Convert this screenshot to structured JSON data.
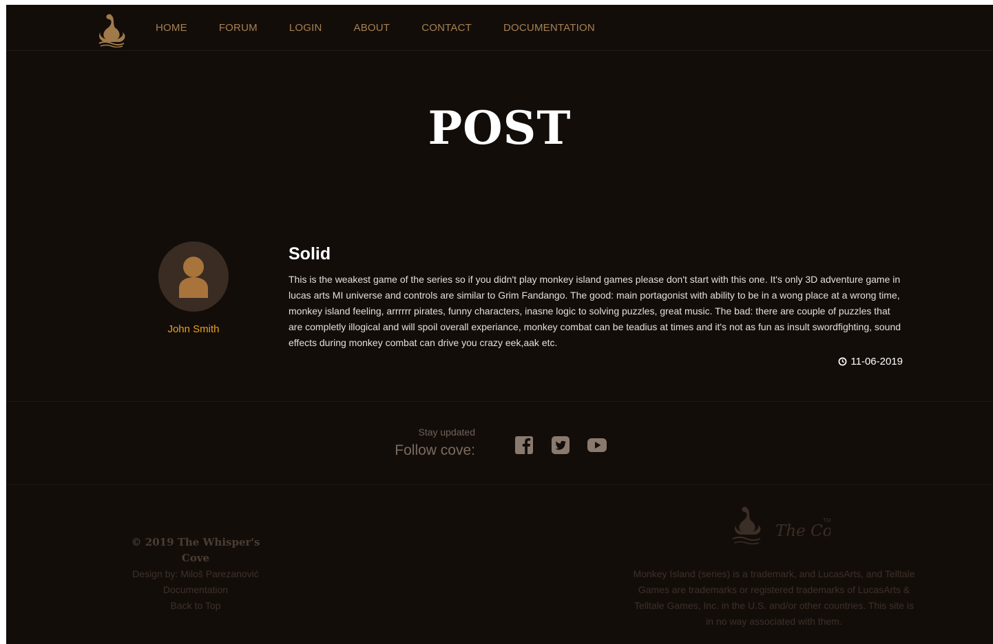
{
  "nav": {
    "items": [
      "HOME",
      "FORUM",
      "LOGIN",
      "ABOUT",
      "CONTACT",
      "DOCUMENTATION"
    ]
  },
  "page_title": "POST",
  "post": {
    "author": "John Smith",
    "title": "Solid",
    "body": "This is the weakest game of the series so if you didn't play monkey island games please don't start with this one. It's only 3D adventure game in lucas arts MI universe and controls are similar to Grim Fandango. The good: main portagonist with ability to be in a wong place at a wrong time, monkey island feeling, arrrrrr pirates, funny characters, inasne logic to solving puzzles, great music. The bad: there are couple of puzzles that are completly illogical and will spoil overall experiance, monkey combat can be teadius at times and it's not as fun as insult swordfighting, sound effects during monkey combat can drive you crazy eek,aak etc.",
    "date": "11-06-2019"
  },
  "social": {
    "stay_updated": "Stay updated",
    "follow": "Follow cove:",
    "icons": [
      "facebook-icon",
      "twitter-icon",
      "youtube-icon"
    ]
  },
  "footer": {
    "copyright": "© 2019 The Whisper's Cove",
    "design": "Design by: Miloš Parezanović",
    "documentation": "Documentation",
    "back_to_top": "Back to Top",
    "logo_text": "The Cove",
    "trademark": "TM",
    "disclaimer": "Monkey Island (series) is a trademark, and LucasArts, and Telltale Games are trademarks or registered trademarks of LucasArts & Telltale Games, Inc. in the U.S. and/or other countries. This site is in no way associated with them."
  },
  "colors": {
    "background": "#130d0a",
    "nav_link": "#a58152",
    "author": "#e8a21b",
    "icon": "#8a7a6e"
  }
}
